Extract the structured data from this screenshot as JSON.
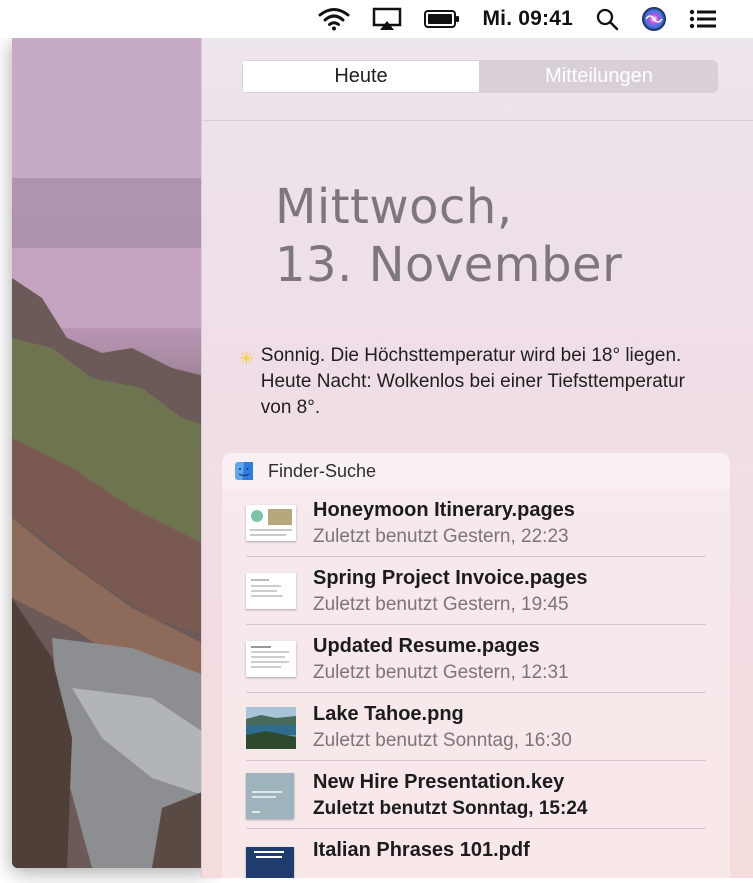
{
  "menubar": {
    "clock": "Mi. 09:41",
    "icons": [
      "wifi-icon",
      "airplay-icon",
      "battery-icon",
      "search-icon",
      "siri-icon",
      "notification-center-icon"
    ]
  },
  "panel": {
    "tabs": [
      {
        "label": "Heute",
        "active": true
      },
      {
        "label": "Mitteilungen",
        "active": false
      }
    ],
    "date": {
      "line1": "Mittwoch,",
      "line2": "13. November"
    },
    "weather": {
      "icon": "sun-icon",
      "text": "Sonnig. Die Höchsttemperatur wird bei 18° liegen. Heute Nacht: Wolkenlos bei einer Tiefsttemperatur von 8°."
    },
    "finder": {
      "title": "Finder-Suche",
      "items": [
        {
          "name": "Honeymoon Itinerary.pages",
          "detail": "Zuletzt benutzt Gestern, 22:23",
          "highlighted": false
        },
        {
          "name": "Spring Project Invoice.pages",
          "detail": "Zuletzt benutzt Gestern, 19:45",
          "highlighted": false
        },
        {
          "name": "Updated Resume.pages",
          "detail": "Zuletzt benutzt Gestern, 12:31",
          "highlighted": false
        },
        {
          "name": "Lake Tahoe.png",
          "detail": "Zuletzt benutzt Sonntag, 16:30",
          "highlighted": false
        },
        {
          "name": "New Hire Presentation.key",
          "detail": "Zuletzt benutzt Sonntag, 15:24",
          "highlighted": true
        },
        {
          "name": "Italian Phrases 101.pdf",
          "detail": "",
          "highlighted": false
        }
      ]
    }
  },
  "colors": {
    "accent_sun": "#f7c52c",
    "finder_blue": "#2f7ce0",
    "tab_inactive_bg": "#d9cfd8"
  }
}
